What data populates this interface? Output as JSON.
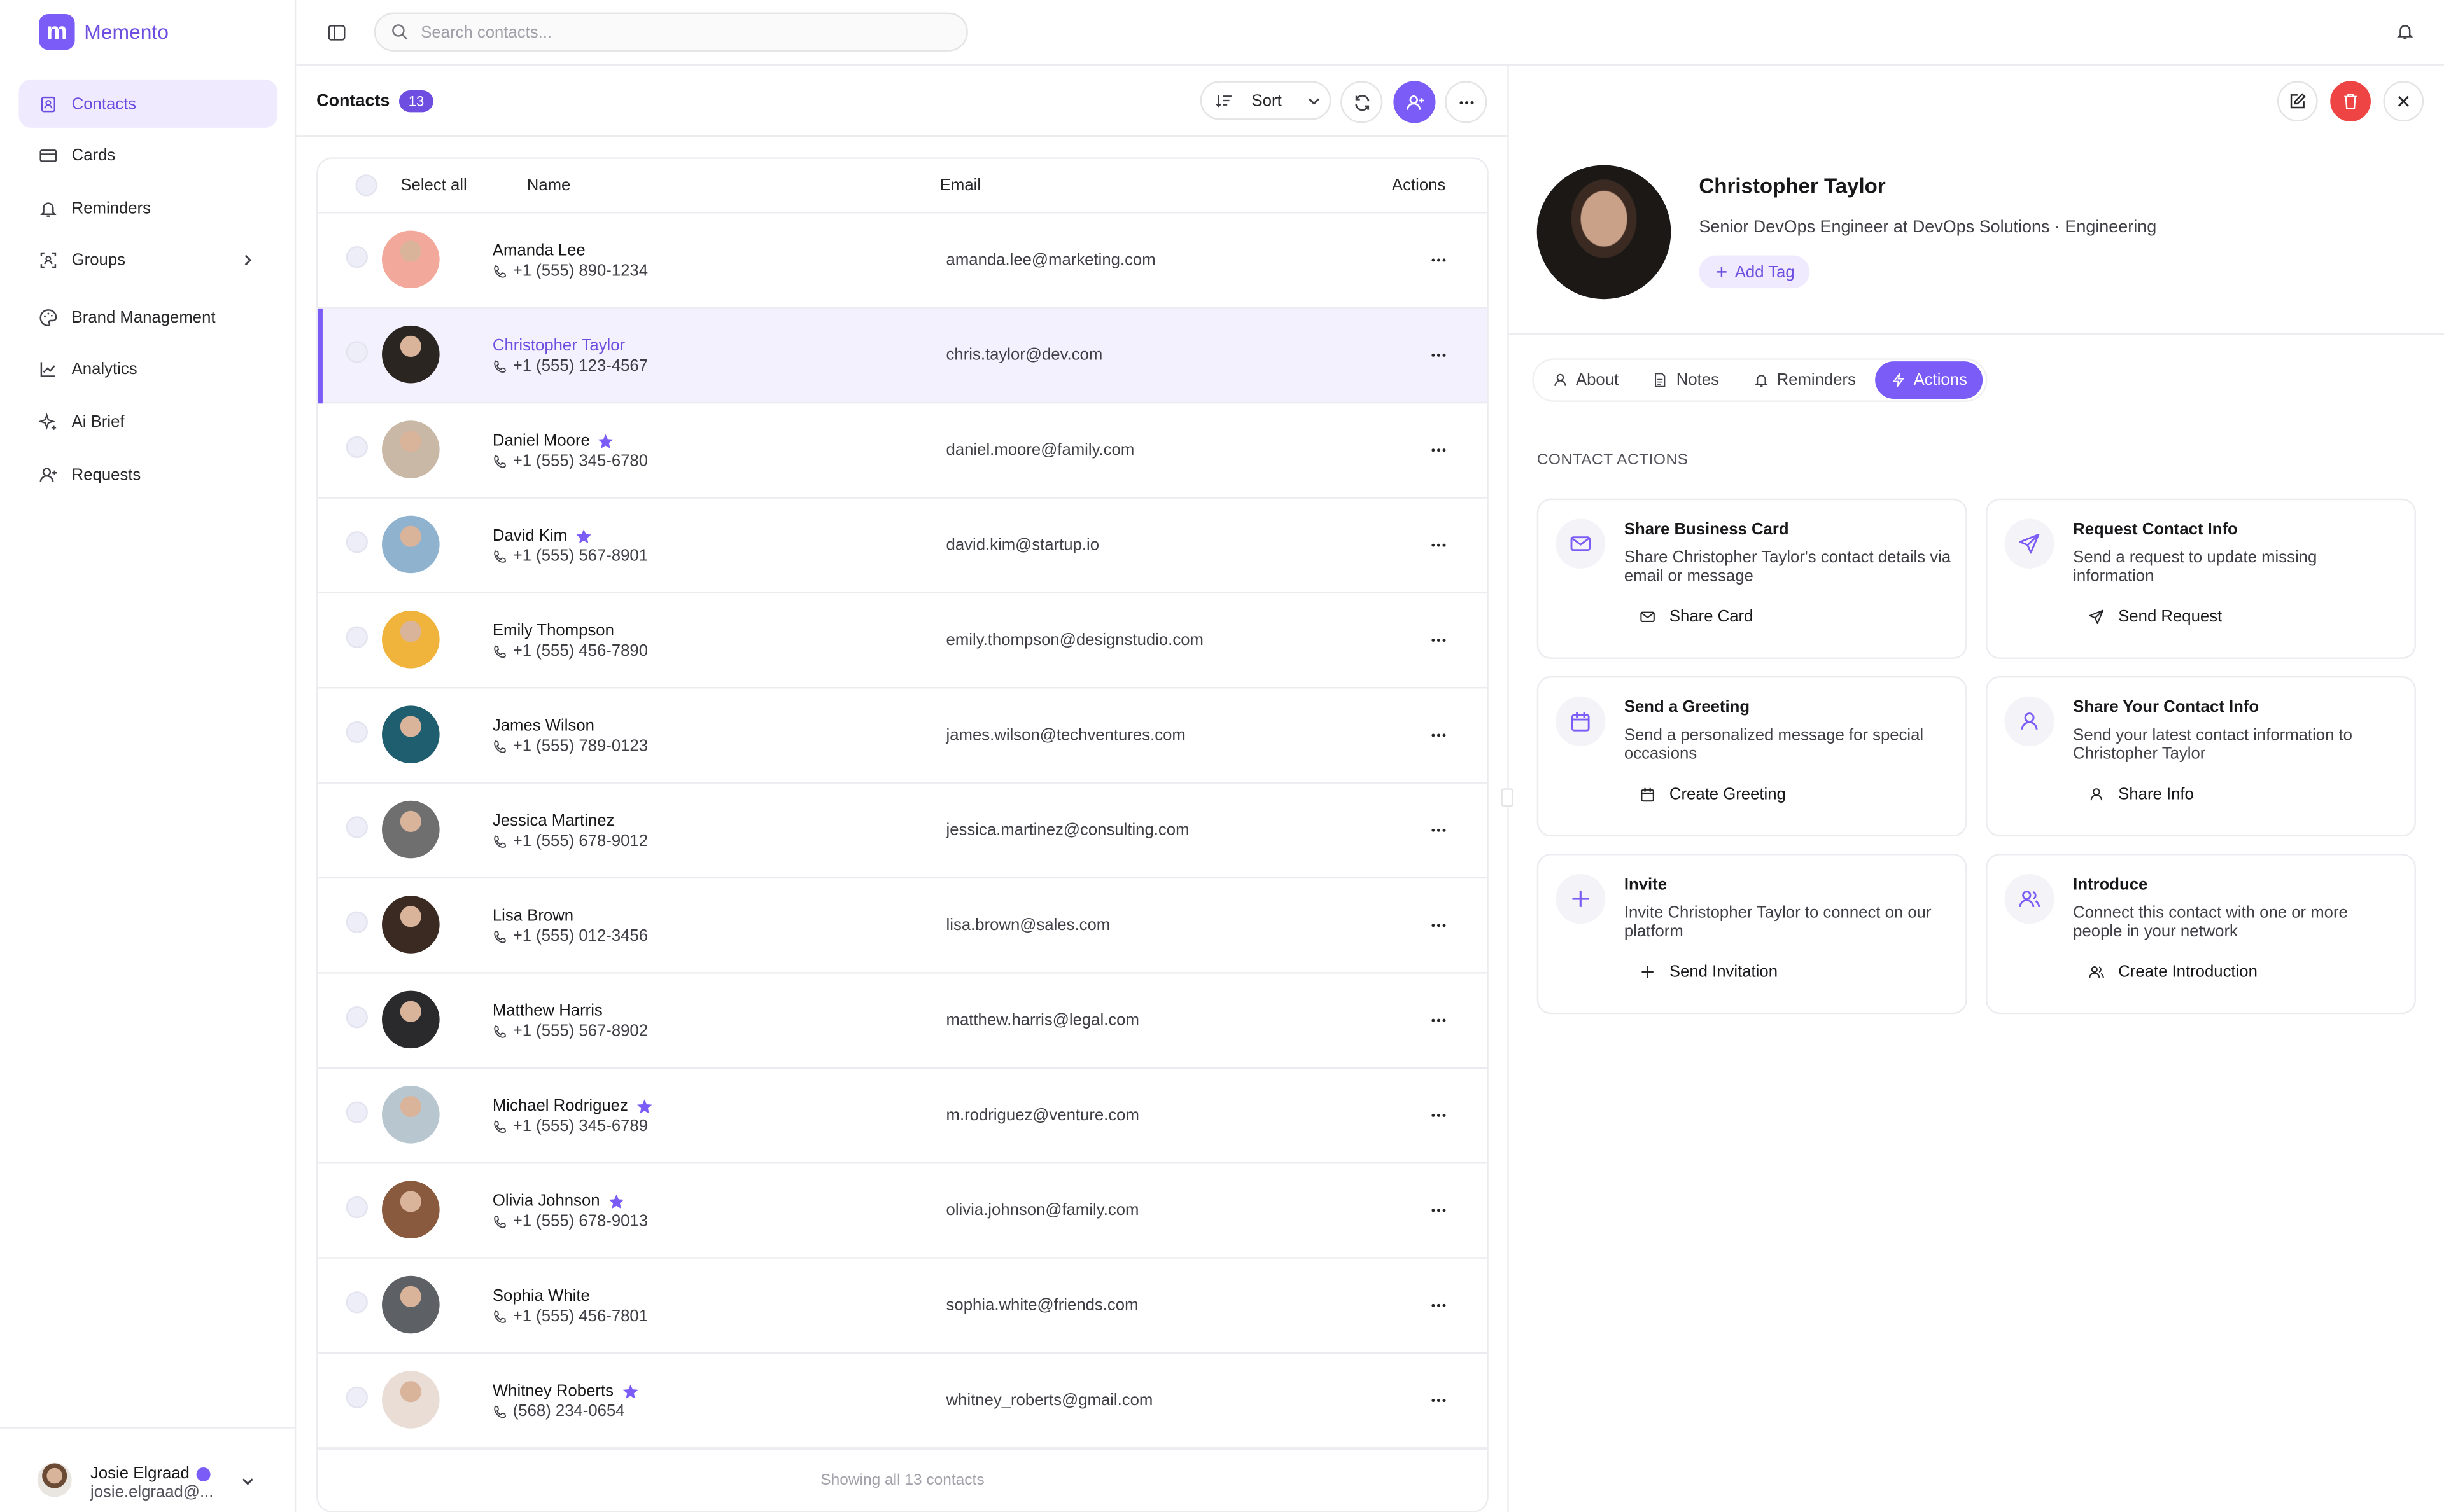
{
  "app": {
    "name": "Memento",
    "logo_letter": "m"
  },
  "search": {
    "placeholder": "Search contacts..."
  },
  "sidebar": {
    "items": [
      {
        "label": "Contacts",
        "icon": "contacts-icon",
        "active": true
      },
      {
        "label": "Cards",
        "icon": "card-icon"
      },
      {
        "label": "Reminders",
        "icon": "bell-icon"
      },
      {
        "label": "Groups",
        "icon": "groups-icon",
        "has_submenu": true
      },
      {
        "label": "Brand Management",
        "icon": "palette-icon"
      },
      {
        "label": "Analytics",
        "icon": "chart-icon"
      },
      {
        "label": "Ai Brief",
        "icon": "sparkles-icon"
      },
      {
        "label": "Requests",
        "icon": "user-plus-icon"
      }
    ]
  },
  "user": {
    "name": "Josie Elgraad",
    "email": "josie.elgraad@..."
  },
  "list": {
    "title": "Contacts",
    "count": "13",
    "sort_label": "Sort",
    "headers": {
      "select_all": "Select all",
      "name": "Name",
      "email": "Email",
      "actions": "Actions"
    },
    "footer": "Showing all 13 contacts",
    "rows": [
      {
        "name": "Amanda Lee",
        "phone": "+1 (555) 890-1234",
        "email": "amanda.lee@marketing.com",
        "starred": false,
        "avatar_color": "#f2a89a"
      },
      {
        "name": "Christopher Taylor",
        "phone": "+1 (555) 123-4567",
        "email": "chris.taylor@dev.com",
        "starred": false,
        "avatar_color": "#2b2522",
        "selected": true
      },
      {
        "name": "Daniel Moore",
        "phone": "+1 (555) 345-6780",
        "email": "daniel.moore@family.com",
        "starred": true,
        "avatar_color": "#c9b8a6"
      },
      {
        "name": "David Kim",
        "phone": "+1 (555) 567-8901",
        "email": "david.kim@startup.io",
        "starred": true,
        "avatar_color": "#8fb2cf"
      },
      {
        "name": "Emily Thompson",
        "phone": "+1 (555) 456-7890",
        "email": "emily.thompson@designstudio.com",
        "starred": false,
        "avatar_color": "#f0b43c"
      },
      {
        "name": "James Wilson",
        "phone": "+1 (555) 789-0123",
        "email": "james.wilson@techventures.com",
        "starred": false,
        "avatar_color": "#1f5e6e"
      },
      {
        "name": "Jessica Martinez",
        "phone": "+1 (555) 678-9012",
        "email": "jessica.martinez@consulting.com",
        "starred": false,
        "avatar_color": "#6f6f6f"
      },
      {
        "name": "Lisa Brown",
        "phone": "+1 (555) 012-3456",
        "email": "lisa.brown@sales.com",
        "starred": false,
        "avatar_color": "#3a2a22"
      },
      {
        "name": "Matthew Harris",
        "phone": "+1 (555) 567-8902",
        "email": "matthew.harris@legal.com",
        "starred": false,
        "avatar_color": "#2a2a2c"
      },
      {
        "name": "Michael Rodriguez",
        "phone": "+1 (555) 345-6789",
        "email": "m.rodriguez@venture.com",
        "starred": true,
        "avatar_color": "#b7c6cf"
      },
      {
        "name": "Olivia Johnson",
        "phone": "+1 (555) 678-9013",
        "email": "olivia.johnson@family.com",
        "starred": true,
        "avatar_color": "#8a5a3e"
      },
      {
        "name": "Sophia White",
        "phone": "+1 (555) 456-7801",
        "email": "sophia.white@friends.com",
        "starred": false,
        "avatar_color": "#5d6064"
      },
      {
        "name": "Whitney Roberts",
        "phone": "(568) 234-0654",
        "email": "whitney_roberts@gmail.com",
        "starred": true,
        "avatar_color": "#e9ddd6"
      }
    ]
  },
  "detail": {
    "name": "Christopher Taylor",
    "role": "Senior DevOps Engineer at DevOps Solutions · Engineering",
    "add_tag": "Add Tag",
    "tabs": [
      {
        "label": "About",
        "icon": "user-icon"
      },
      {
        "label": "Notes",
        "icon": "note-icon"
      },
      {
        "label": "Reminders",
        "icon": "bell-icon"
      },
      {
        "label": "Actions",
        "icon": "bolt-icon",
        "active": true
      }
    ],
    "section_label": "CONTACT ACTIONS",
    "cards": [
      {
        "title": "Share Business Card",
        "desc": "Share Christopher Taylor's contact details via email or message",
        "button": "Share Card",
        "icon": "mail-icon",
        "button_icon": "mail-icon"
      },
      {
        "title": "Request Contact Info",
        "desc": "Send a request to update missing information",
        "button": "Send Request",
        "icon": "send-icon",
        "button_icon": "send-icon"
      },
      {
        "title": "Send a Greeting",
        "desc": "Send a personalized message for special occasions",
        "button": "Create Greeting",
        "icon": "calendar-icon",
        "button_icon": "calendar-icon"
      },
      {
        "title": "Share Your Contact Info",
        "desc": "Send your latest contact information to Christopher Taylor",
        "button": "Share Info",
        "icon": "user-icon",
        "button_icon": "user-icon"
      },
      {
        "title": "Invite",
        "desc": "Invite Christopher Taylor to connect on our platform",
        "button": "Send Invitation",
        "icon": "plus-icon",
        "button_icon": "plus-icon"
      },
      {
        "title": "Introduce",
        "desc": "Connect this contact with one or more people in your network",
        "button": "Create Introduction",
        "icon": "users-icon",
        "button_icon": "users-icon"
      }
    ]
  },
  "colors": {
    "accent": "#7c5cf6",
    "accent_dark": "#6d4ee0",
    "danger": "#ef4444"
  }
}
